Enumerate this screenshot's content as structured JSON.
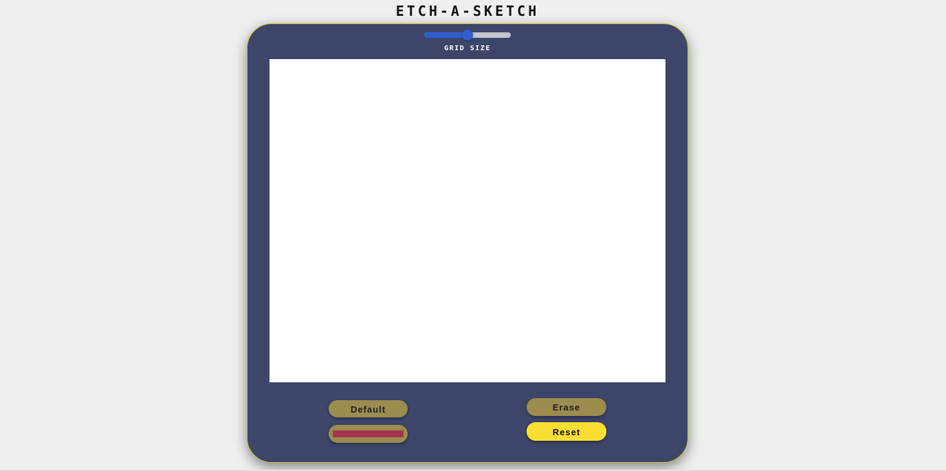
{
  "title": "ETCH-A-SKETCH",
  "grid_size": {
    "label": "GRID SIZE",
    "value_fraction": 0.5
  },
  "buttons": {
    "default_label": "Default",
    "erase_label": "Erase",
    "reset_label": "Reset"
  },
  "colors": {
    "board": "#3d4569",
    "board_border": "#c9c23a",
    "button": "#9c8c4e",
    "reset_button": "#f9df31",
    "selected_color": "#a33553",
    "slider_accent": "#2f5fd0"
  }
}
